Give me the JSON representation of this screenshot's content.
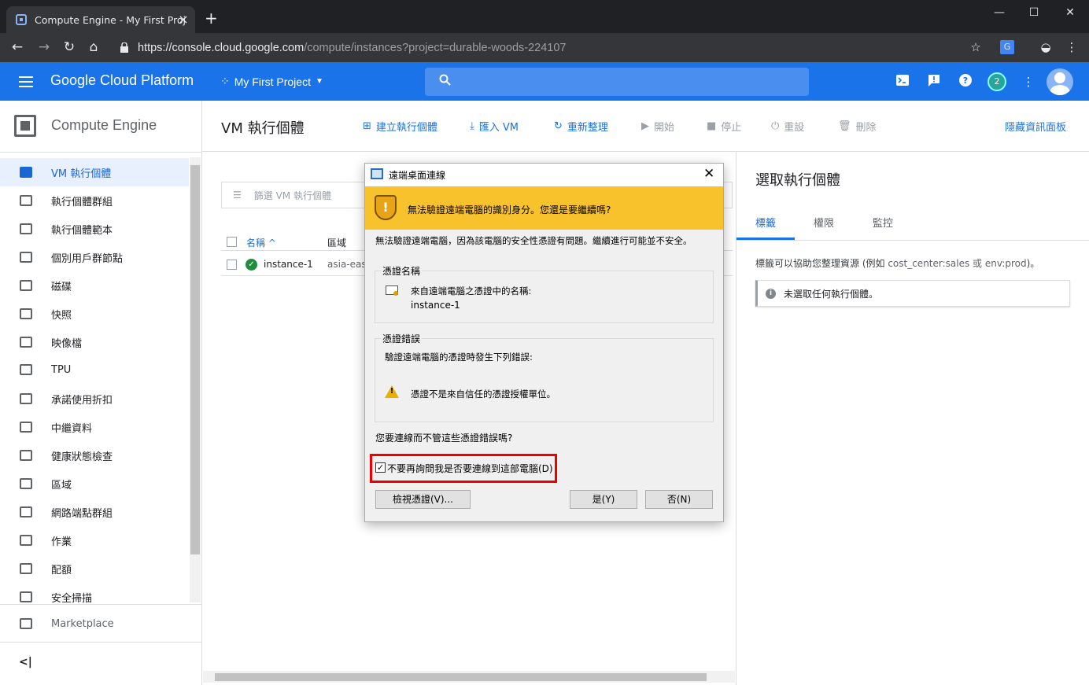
{
  "browser": {
    "tab_title": "Compute Engine - My First Proj",
    "url_host": "https://console.cloud.google.com",
    "url_path": "/compute/instances?project=durable-woods-224107"
  },
  "header": {
    "brand": "Google Cloud Platform",
    "project": "My First Project",
    "notifications": "2"
  },
  "sidebar": {
    "title": "Compute Engine",
    "items": [
      {
        "label": "VM 執行個體",
        "icon": "vm-instance-icon"
      },
      {
        "label": "執行個體群組",
        "icon": "instance-group-icon"
      },
      {
        "label": "執行個體範本",
        "icon": "instance-template-icon"
      },
      {
        "label": "個別用戶群節點",
        "icon": "sole-tenant-icon"
      },
      {
        "label": "磁碟",
        "icon": "disk-icon"
      },
      {
        "label": "快照",
        "icon": "snapshot-icon"
      },
      {
        "label": "映像檔",
        "icon": "image-icon"
      },
      {
        "label": "TPU",
        "icon": "tpu-icon"
      },
      {
        "label": "承諾使用折扣",
        "icon": "percent-icon"
      },
      {
        "label": "中繼資料",
        "icon": "metadata-icon"
      },
      {
        "label": "健康狀態檢查",
        "icon": "health-check-icon"
      },
      {
        "label": "區域",
        "icon": "zone-icon"
      },
      {
        "label": "網路端點群組",
        "icon": "network-endpoint-icon"
      },
      {
        "label": "作業",
        "icon": "operations-icon"
      },
      {
        "label": "配額",
        "icon": "quota-icon"
      },
      {
        "label": "安全掃描",
        "icon": "security-scan-icon"
      }
    ],
    "marketplace": "Marketplace",
    "collapse": "<|"
  },
  "toolbar": {
    "page_title": "VM 執行個體",
    "create": "建立執行個體",
    "import": "匯入 VM",
    "refresh": "重新整理",
    "start": "開始",
    "stop": "停止",
    "reset": "重設",
    "delete": "刪除",
    "hide_panel": "隱藏資訊面板"
  },
  "table": {
    "filter_placeholder": "篩選 VM 執行個體",
    "headers": [
      "名稱 ^",
      "區域"
    ],
    "rows": [
      {
        "name": "instance-1",
        "zone": "asia-east"
      }
    ]
  },
  "right_panel": {
    "title": "選取執行個體",
    "tabs": [
      "標籤",
      "權限",
      "監控"
    ],
    "desc_prefix": "標籤可以協助您整理資源 (例如 ",
    "desc_example": "cost_center:sales 或 env:prod",
    "desc_suffix": ")。",
    "info": "未選取任何執行個體。"
  },
  "dialog": {
    "title": "遠端桌面連線",
    "warning": "無法驗證遠端電腦的識別身分。您還是要繼續嗎?",
    "description": "無法驗證遠端電腦，因為該電腦的安全性憑證有問題。繼續進行可能並不安全。",
    "group1_title": "憑證名稱",
    "group1_line1": "來自遠端電腦之憑證中的名稱:",
    "group1_line2": "instance-1",
    "group2_title": "憑證錯誤",
    "group2_line1": "驗證遠端電腦的憑證時發生下列錯誤:",
    "group2_error": "憑證不是來自信任的憑證授權單位。",
    "question": "您要連線而不管這些憑證錯誤嗎?",
    "checkbox_label": "不要再詢問我是否要連線到這部電腦(D)",
    "checkbox_checked": true,
    "view_cert": "檢視憑證(V)...",
    "yes": "是(Y)",
    "no": "否(N)"
  }
}
